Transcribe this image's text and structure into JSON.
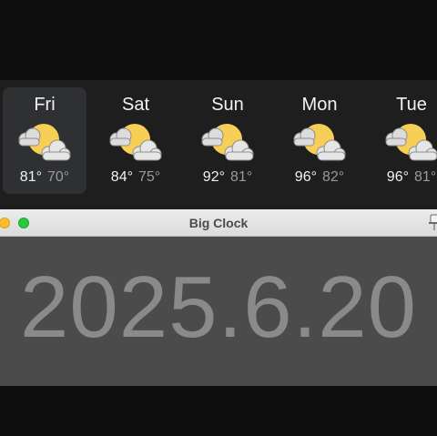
{
  "weather": {
    "days": [
      {
        "name": "Fri",
        "high": "81°",
        "low": "70°",
        "icon": "partly-cloudy-icon",
        "selected": true
      },
      {
        "name": "Sat",
        "high": "84°",
        "low": "75°",
        "icon": "partly-cloudy-icon",
        "selected": false
      },
      {
        "name": "Sun",
        "high": "92°",
        "low": "81°",
        "icon": "partly-cloudy-icon",
        "selected": false
      },
      {
        "name": "Mon",
        "high": "96°",
        "low": "82°",
        "icon": "partly-cloudy-icon",
        "selected": false
      },
      {
        "name": "Tue",
        "high": "96°",
        "low": "81°",
        "icon": "partly-cloudy-icon",
        "selected": false
      }
    ]
  },
  "clock_window": {
    "title": "Big Clock",
    "display": "2025.6.20"
  },
  "colors": {
    "sun": "#f7cf56",
    "cloud": "#e2e2e2",
    "window_yellow": "#febc2e",
    "window_green": "#28c840"
  }
}
